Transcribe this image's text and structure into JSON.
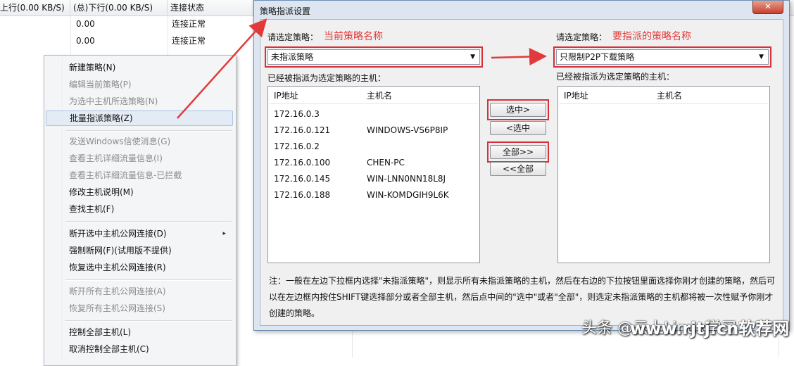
{
  "background": {
    "headers": [
      "上行(0.00 KB/S)",
      "(总)下行(0.00 KB/S)",
      "连接状态"
    ],
    "rows": [
      {
        "value": "0.00",
        "status": "连接正常"
      },
      {
        "value": "0.00",
        "status": "连接正常"
      }
    ]
  },
  "context_menu": {
    "items": [
      {
        "label": "新建策略(N)",
        "disabled": false
      },
      {
        "label": "编辑当前策略(P)",
        "disabled": true
      },
      {
        "label": "为选中主机所选策略(N)",
        "disabled": true
      },
      {
        "label": "批量指派策略(Z)",
        "disabled": false,
        "hover": true
      },
      {
        "label": "发送Windows信使消息(G)",
        "disabled": true
      },
      {
        "label": "查看主机详细流量信息(I)",
        "disabled": true
      },
      {
        "label": "查看主机详细流量信息-已拦截",
        "disabled": true
      },
      {
        "label": "修改主机说明(M)",
        "disabled": false
      },
      {
        "label": "查找主机(F)",
        "disabled": false
      },
      {
        "label": "断开选中主机公网连接(D)",
        "disabled": false,
        "submenu": true
      },
      {
        "label": "强制断网(F)(试用版不提供)",
        "disabled": false
      },
      {
        "label": "恢复选中主机公网连接(R)",
        "disabled": false
      },
      {
        "label": "断开所有主机公网连接(A)",
        "disabled": true
      },
      {
        "label": "恢复所有主机公网连接(S)",
        "disabled": true
      },
      {
        "label": "控制全部主机(L)",
        "disabled": false
      },
      {
        "label": "取消控制全部主机(C)",
        "disabled": false
      }
    ],
    "submenu_arrow": "▸"
  },
  "dialog": {
    "title": "策略指派设置",
    "close_label": "✕",
    "left_select_label": "请选定策略：",
    "left_note": "当前策略名称",
    "left_combo_value": "未指派策略",
    "right_select_label": "请选定策略：",
    "right_note": "要指派的策略名称",
    "right_combo_value": "只限制P2P下载策略",
    "left_list_label": "已经被指派为选定策略的主机：",
    "right_list_label": "已经被指派为选定策略的主机：",
    "col_ip": "IP地址",
    "col_host": "主机名",
    "left_hosts": [
      {
        "ip": "172.16.0.3",
        "name": ""
      },
      {
        "ip": "172.16.0.121",
        "name": "WINDOWS-VS6P8IP"
      },
      {
        "ip": "172.16.0.2",
        "name": ""
      },
      {
        "ip": "172.16.0.100",
        "name": "CHEN-PC"
      },
      {
        "ip": "172.16.0.145",
        "name": "WIN-LNN0NN18L8J"
      },
      {
        "ip": "172.16.0.188",
        "name": "WIN-KOMDGIH9L6K"
      }
    ],
    "buttons": {
      "select": "选中>",
      "unselect": "<选中",
      "all": "全部>>",
      "unall": "<<全部"
    },
    "note": "注：一般在左边下拉框内选择\"未指派策略\"，则显示所有未指派策略的主机，然后在右边的下拉按钮里面选择你刚才创建的策略，然后可以在左边框内按住SHIFT键选择部分或者全部主机，然后点中间的\"选中\"或者\"全部\"，则选定未指派策略的主机都将被一次性赋予你刚才创建的策略。",
    "combo_arrow": "▼"
  },
  "watermark": {
    "left": "头条 @云上Linux学习",
    "right": "www.rjtj.cn软荐网"
  },
  "colors": {
    "annotation_red": "#e23a3a",
    "dialog_frame": "#dde6f0"
  }
}
